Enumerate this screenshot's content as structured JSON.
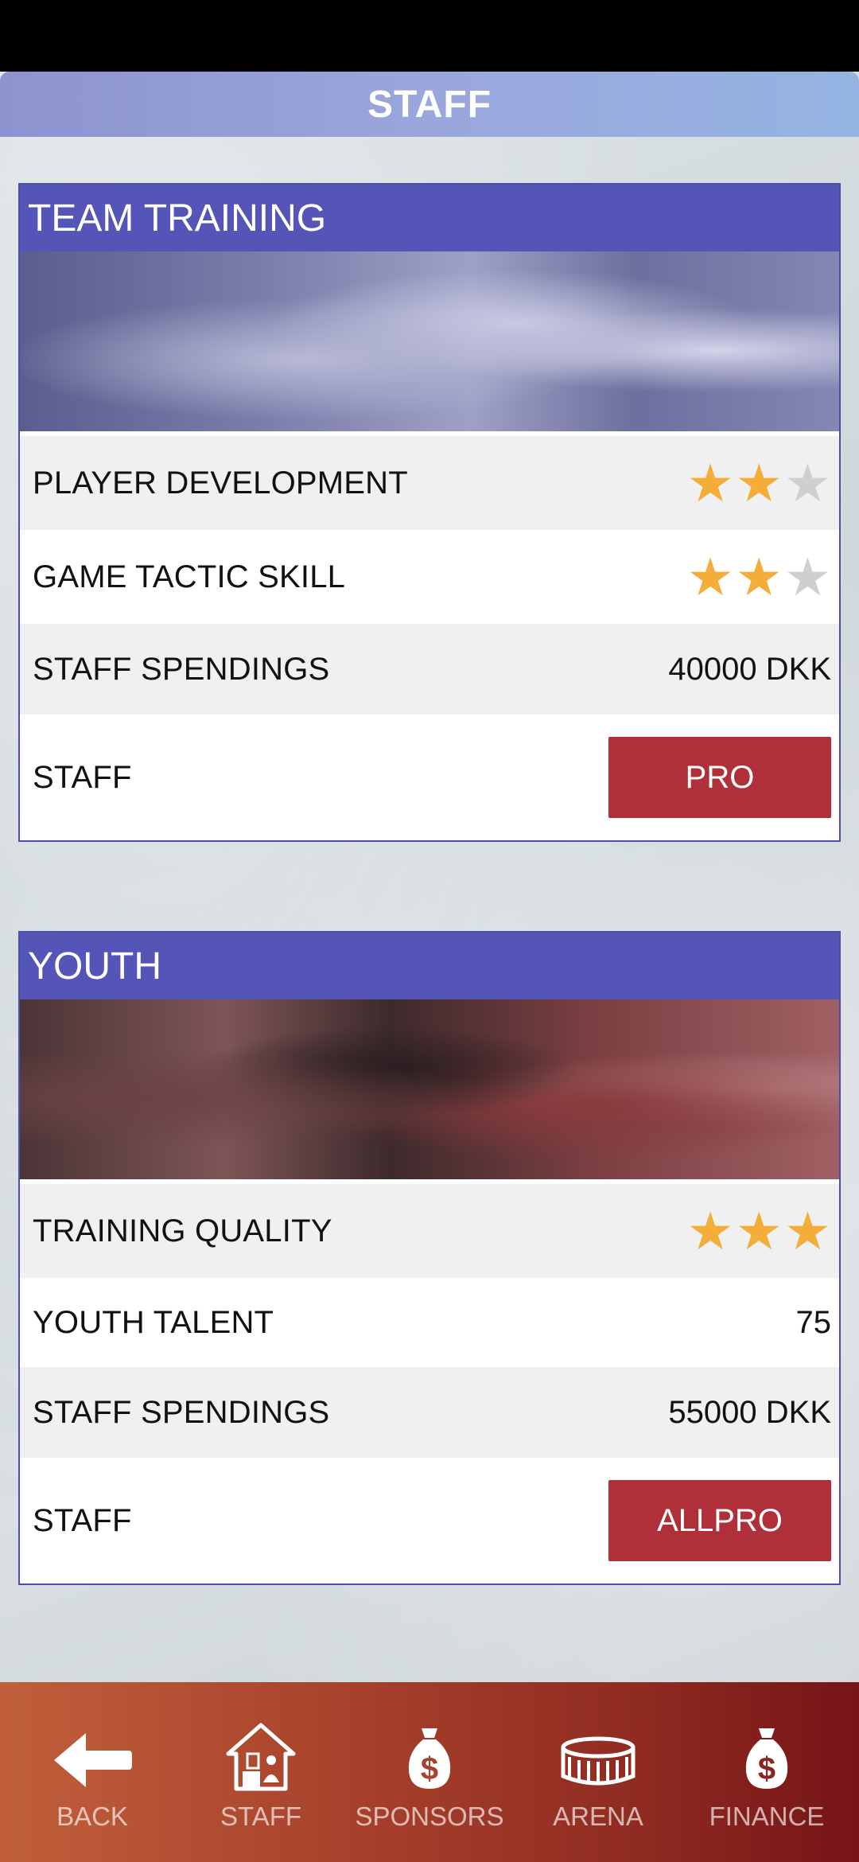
{
  "header": {
    "title": "STAFF"
  },
  "cards": [
    {
      "title": "TEAM TRAINING",
      "image_icon": "running-athletes-photo",
      "rows": [
        {
          "label": "PLAYER DEVELOPMENT",
          "stars": 2,
          "max_stars": 3
        },
        {
          "label": "GAME TACTIC SKILL",
          "stars": 2,
          "max_stars": 3
        },
        {
          "label": "STAFF SPENDINGS",
          "value": "40000 DKK"
        },
        {
          "label": "STAFF",
          "button": "PRO"
        }
      ]
    },
    {
      "title": "YOUTH",
      "image_icon": "youth-hockey-players-photo",
      "rows": [
        {
          "label": "TRAINING QUALITY",
          "stars": 3,
          "max_stars": 3
        },
        {
          "label": "YOUTH TALENT",
          "value": "75"
        },
        {
          "label": "STAFF SPENDINGS",
          "value": "55000 DKK"
        },
        {
          "label": "STAFF",
          "button": "ALLPRO"
        }
      ]
    }
  ],
  "nav": [
    {
      "label": "BACK",
      "icon": "back-arrow-icon"
    },
    {
      "label": "STAFF",
      "icon": "house-staff-icon"
    },
    {
      "label": "SPONSORS",
      "icon": "money-bag-icon"
    },
    {
      "label": "ARENA",
      "icon": "arena-icon"
    },
    {
      "label": "FINANCE",
      "icon": "money-bag-icon"
    }
  ],
  "colors": {
    "header_gradient": [
      "#8d93cf",
      "#95b4e2"
    ],
    "card_title_bar": "#5555b8",
    "star_on": "#f3ad38",
    "star_off": "#cfcfd1",
    "staff_button": "#b0303a",
    "nav_gradient": [
      "#c05f3b",
      "#761417"
    ]
  }
}
